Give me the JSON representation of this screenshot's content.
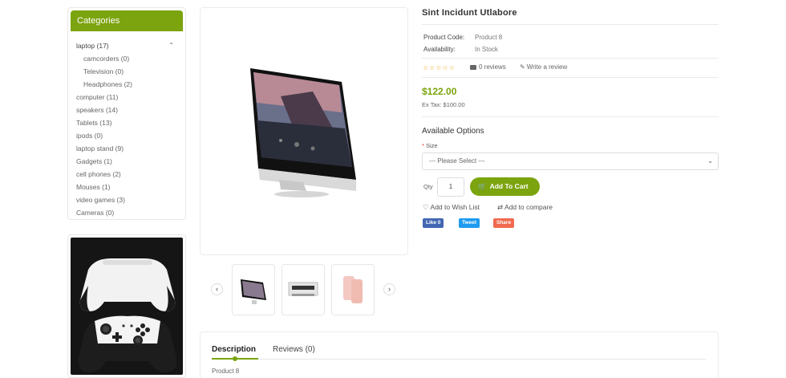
{
  "sidebar": {
    "title": "Categories",
    "categories": [
      {
        "label": "laptop (17)",
        "expanded": true
      },
      {
        "label": "camcorders (0)",
        "sub": true
      },
      {
        "label": "Television (0)",
        "sub": true
      },
      {
        "label": "Headphones (2)",
        "sub": true
      },
      {
        "label": "computer (11)"
      },
      {
        "label": "speakers (14)"
      },
      {
        "label": "Tablets (13)"
      },
      {
        "label": "ipods (0)"
      },
      {
        "label": "laptop stand (9)"
      },
      {
        "label": "Gadgets (1)"
      },
      {
        "label": "cell phones (2)"
      },
      {
        "label": "Mouses (1)"
      },
      {
        "label": "video games (3)"
      },
      {
        "label": "Cameras (0)"
      }
    ]
  },
  "product": {
    "title": "Sint Incidunt Utlabore",
    "code_label": "Product Code:",
    "code_value": "Product 8",
    "availability_label": "Availability:",
    "availability_value": "In Stock",
    "stars": "☆☆☆☆☆",
    "reviews": "0 reviews",
    "write_review": "Write a review",
    "price": "$122.00",
    "ex_tax": "Ex Tax: $100.00",
    "options_title": "Available Options",
    "size_label": "Size",
    "size_placeholder": "--- Please Select ---",
    "qty_label": "Qty",
    "qty_value": "1",
    "add_to_cart": "Add To Cart",
    "wish_list": "Add to Wish List",
    "compare": "Add to compare",
    "social": {
      "like": "Like 0",
      "tweet": "Tweet",
      "share": "Share"
    }
  },
  "tabs": [
    {
      "label": "Description"
    },
    {
      "label": "Reviews (0)"
    }
  ],
  "description_text": "Product 8",
  "colors": {
    "accent": "#7ba40e",
    "facebook": "#4267b2",
    "twitter": "#1d9bf0",
    "share": "#f06b4f",
    "stars": "#f0a820"
  },
  "icons": {
    "thumb_prev": "chevron-left-icon",
    "thumb_next": "chevron-right-icon",
    "cart": "cart-icon",
    "heart": "heart-icon",
    "compare": "compare-icon"
  }
}
